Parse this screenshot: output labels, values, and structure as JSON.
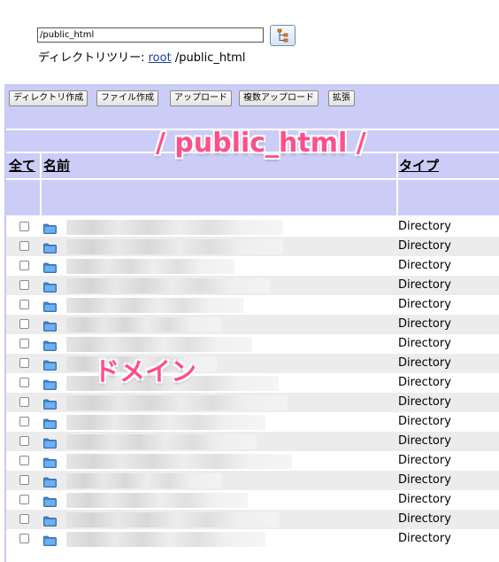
{
  "path_input": {
    "value": "/public_html"
  },
  "breadcrumb": {
    "prefix": "ディレクトリツリー:",
    "root_link": "root",
    "current": "/public_html"
  },
  "toolbar": {
    "buttons": [
      "ディレクトリ作成",
      "ファイル作成",
      "アップロード",
      "複数アップロード",
      "拡張"
    ]
  },
  "annotations": {
    "title": "/ public_html /",
    "domain": "ドメイン"
  },
  "table": {
    "headers": {
      "select_all": "全て",
      "name": "名前",
      "type": "タイプ"
    },
    "rows": [
      {
        "type": "Directory"
      },
      {
        "type": "Directory"
      },
      {
        "type": "Directory"
      },
      {
        "type": "Directory"
      },
      {
        "type": "Directory"
      },
      {
        "type": "Directory"
      },
      {
        "type": "Directory"
      },
      {
        "type": "Directory"
      },
      {
        "type": "Directory"
      },
      {
        "type": "Directory"
      },
      {
        "type": "Directory"
      },
      {
        "type": "Directory"
      },
      {
        "type": "Directory"
      },
      {
        "type": "Directory"
      },
      {
        "type": "Directory"
      },
      {
        "type": "Directory"
      },
      {
        "type": "Directory"
      }
    ]
  },
  "colors": {
    "panel_bg": "#cbcdf6",
    "link": "#1a3fb5",
    "annotation": "#ff4f8a",
    "row_alt": "#ececec"
  }
}
